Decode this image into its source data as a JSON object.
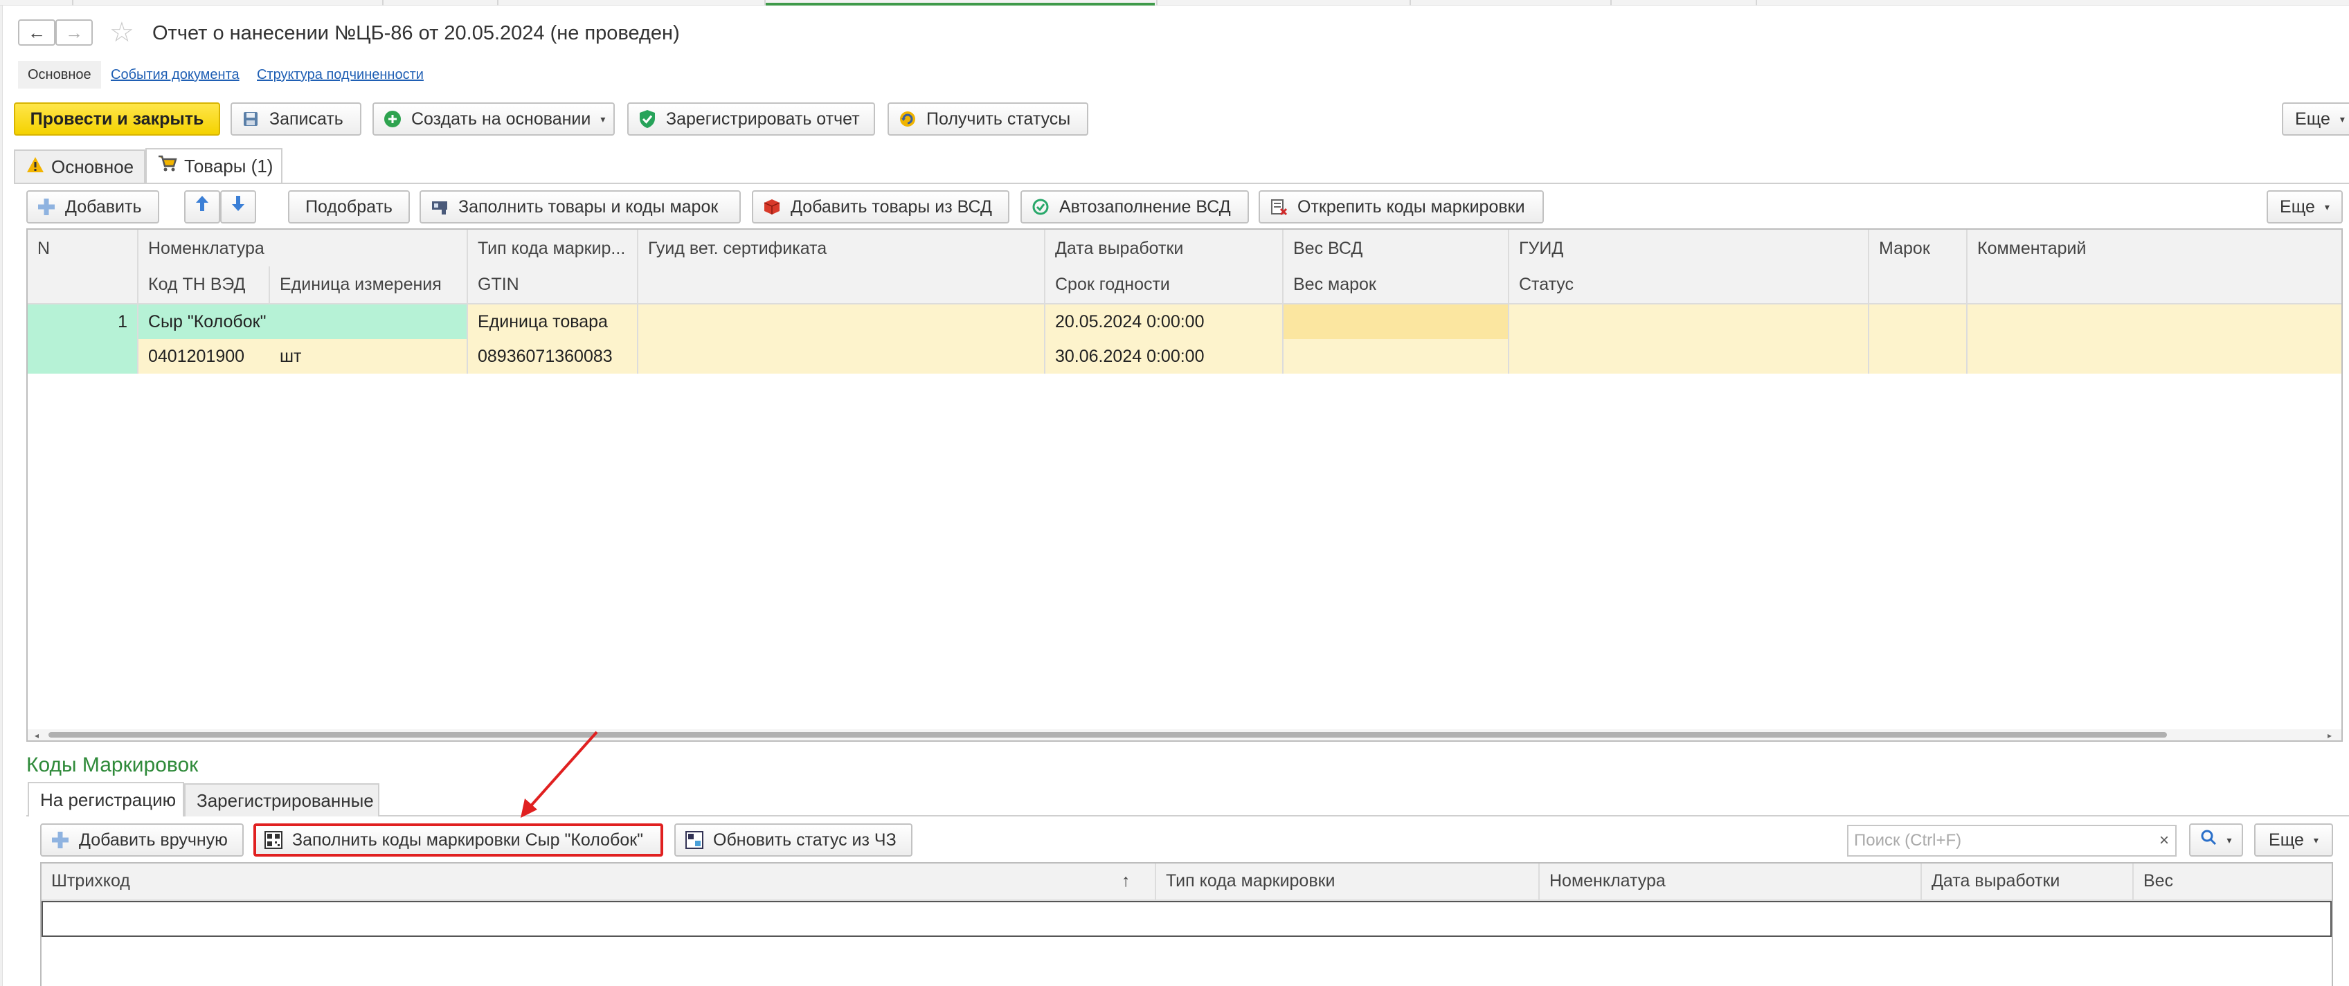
{
  "window": {
    "title": "Отчет о нанесении №ЦБ-86 от 20.05.2024 (не проведен)",
    "nav_back": "←",
    "nav_forward": "→",
    "favorite_icon": "star-icon"
  },
  "form_tabs": [
    "Основное",
    "События документа",
    "Структура подчиненности"
  ],
  "command_bar": {
    "post_close": "Провести и закрыть",
    "save": "Записать",
    "create_based": "Создать на основании",
    "register_report": "Зарегистрировать отчет",
    "get_statuses": "Получить статусы",
    "more": "Еще"
  },
  "page_tabs": [
    {
      "label": "Основное",
      "icon": "warning-icon"
    },
    {
      "label": "Товары (1)",
      "icon": "cart-icon"
    }
  ],
  "goods_toolbar": {
    "add": "Добавить",
    "move_up": "↑",
    "move_down": "↓",
    "pick": "Подобрать",
    "fill_goods_codes": "Заполнить товары и коды марок",
    "add_from_vsd": "Добавить товары из ВСД",
    "autofill_vsd": "Автозаполнение ВСД",
    "unpin_codes": "Открепить коды маркировки",
    "more": "Еще"
  },
  "goods_table": {
    "headers_row1": [
      "N",
      "Номенклатура",
      "Тип кода маркир...",
      "Гуид вет. сертификата",
      "Дата выработки",
      "Вес ВСД",
      "ГУИД",
      "Марок",
      "Комментарий"
    ],
    "headers_row2": [
      "Код ТН ВЭД",
      "Единица измерения",
      "GTIN",
      "Срок годности",
      "Вес марок",
      "Статус"
    ],
    "rows": [
      {
        "n": "1",
        "nomenclature": "Сыр \"Колобок\"",
        "code_type": "Единица товара",
        "production_date": "20.05.2024 0:00:00",
        "tnved": "0401201900",
        "unit": "шт",
        "gtin": "08936071360083",
        "expiry": "30.06.2024 0:00:00"
      }
    ]
  },
  "codes_section": {
    "title": "Коды Маркировок",
    "tabs": [
      "На регистрацию",
      "Зарегистрированные"
    ],
    "add_manual": "Добавить вручную",
    "fill_codes": "Заполнить коды маркировки Сыр \"Колобок\"",
    "update_status": "Обновить статус из ЧЗ",
    "search_placeholder": "Поиск (Ctrl+F)",
    "search_clear": "×",
    "more": "Еще",
    "headers": [
      "Штрихкод",
      "↑",
      "Тип кода маркировки",
      "Номенклатура",
      "Дата выработки",
      "Вес"
    ]
  },
  "colors": {
    "primary_button": "#f4d200",
    "selected_n_cell": "#b6f2d6",
    "row_highlight": "#fdf3cc",
    "weight_cell": "#fbe6a0",
    "section_title": "#2f8a3a",
    "annotation": "#e02020"
  }
}
